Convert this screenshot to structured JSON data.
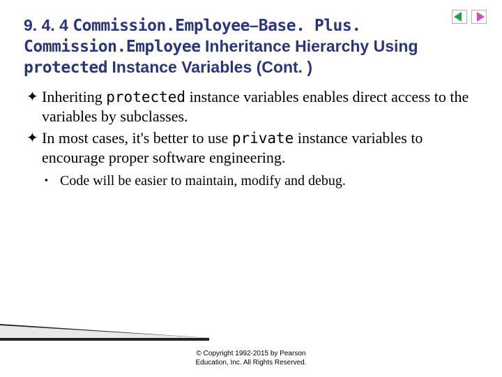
{
  "nav": {
    "prev_color": "#2aa03a",
    "next_color": "#d24ac0"
  },
  "title": {
    "section": "9. 4. 4 ",
    "part1_mono": "Commission.Employee",
    "dash": "–",
    "part2_mono": "Base. Plus. Commission.Employee",
    "rest1": " Inheritance Hierarchy Using ",
    "protected": "protected",
    "rest2": " Instance Variables (Cont. )"
  },
  "bullets": {
    "level1": [
      {
        "pre": "Inheriting ",
        "mono": "protected",
        "post": " instance variables enables direct access to the variables by subclasses."
      },
      {
        "pre": "In most cases, it's better to use ",
        "mono": "private",
        "post": " instance variables to encourage proper software engineering."
      }
    ],
    "level2": [
      {
        "text": "Code will be easier to maintain, modify and debug."
      }
    ],
    "marker1": "✦",
    "marker2": "▪"
  },
  "copyright": {
    "line1": "© Copyright 1992-2015 by Pearson",
    "line2": "Education, Inc. All Rights Reserved."
  }
}
